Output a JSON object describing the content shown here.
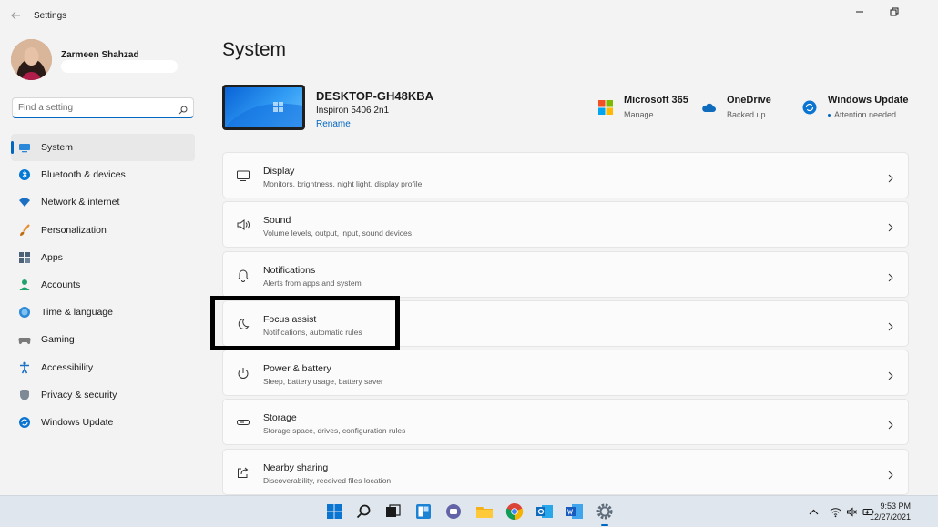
{
  "window": {
    "app_title": "Settings",
    "icons": {
      "back": "back-arrow-icon",
      "minimize": "minimize-icon",
      "maximize": "maximize-icon"
    }
  },
  "profile": {
    "name": "Zarmeen Shahzad"
  },
  "search": {
    "placeholder": "Find a setting",
    "icon": "search-icon"
  },
  "nav": {
    "items": [
      {
        "label": "System",
        "icon": "system-display-icon",
        "selected": true
      },
      {
        "label": "Bluetooth & devices",
        "icon": "bluetooth-icon"
      },
      {
        "label": "Network & internet",
        "icon": "wifi-icon"
      },
      {
        "label": "Personalization",
        "icon": "brush-icon"
      },
      {
        "label": "Apps",
        "icon": "apps-icon"
      },
      {
        "label": "Accounts",
        "icon": "person-icon"
      },
      {
        "label": "Time & language",
        "icon": "globe-clock-icon"
      },
      {
        "label": "Gaming",
        "icon": "gamepad-icon"
      },
      {
        "label": "Accessibility",
        "icon": "accessibility-icon"
      },
      {
        "label": "Privacy & security",
        "icon": "shield-icon"
      },
      {
        "label": "Windows Update",
        "icon": "update-icon"
      }
    ]
  },
  "main": {
    "page_title": "System",
    "device": {
      "name": "DESKTOP-GH48KBA",
      "model": "Inspiron 5406 2n1",
      "rename_label": "Rename"
    },
    "quick_status": [
      {
        "title": "Microsoft 365",
        "sub": "Manage",
        "icon": "microsoft-365-icon"
      },
      {
        "title": "OneDrive",
        "sub": "Backed up",
        "icon": "onedrive-cloud-icon"
      },
      {
        "title": "Windows Update",
        "sub": "Attention needed",
        "icon": "windows-update-icon"
      }
    ],
    "cards": [
      {
        "title": "Display",
        "desc": "Monitors, brightness, night light, display profile",
        "icon": "monitor-icon"
      },
      {
        "title": "Sound",
        "desc": "Volume levels, output, input, sound devices",
        "icon": "speaker-icon"
      },
      {
        "title": "Notifications",
        "desc": "Alerts from apps and system",
        "icon": "bell-icon"
      },
      {
        "title": "Focus assist",
        "desc": "Notifications, automatic rules",
        "icon": "moon-icon"
      },
      {
        "title": "Power & battery",
        "desc": "Sleep, battery usage, battery saver",
        "icon": "power-icon"
      },
      {
        "title": "Storage",
        "desc": "Storage space, drives, configuration rules",
        "icon": "storage-drive-icon"
      },
      {
        "title": "Nearby sharing",
        "desc": "Discoverability, received files location",
        "icon": "share-icon"
      }
    ]
  },
  "taskbar": {
    "apps": [
      "windows-start-icon",
      "search-icon",
      "task-view-icon",
      "widgets-icon",
      "teams-chat-icon",
      "file-explorer-icon",
      "chrome-icon",
      "outlook-icon",
      "word-icon",
      "settings-gear-icon"
    ],
    "tray": [
      "chevron-up-icon",
      "wifi-icon",
      "volume-icon",
      "battery-icon"
    ],
    "time": "9:53 PM",
    "date": "12/27/2021"
  },
  "colors": {
    "accent": "#0067c0",
    "background": "#f3f3f3",
    "card": "#fbfbfb",
    "taskbar": "#dfe6ee"
  }
}
